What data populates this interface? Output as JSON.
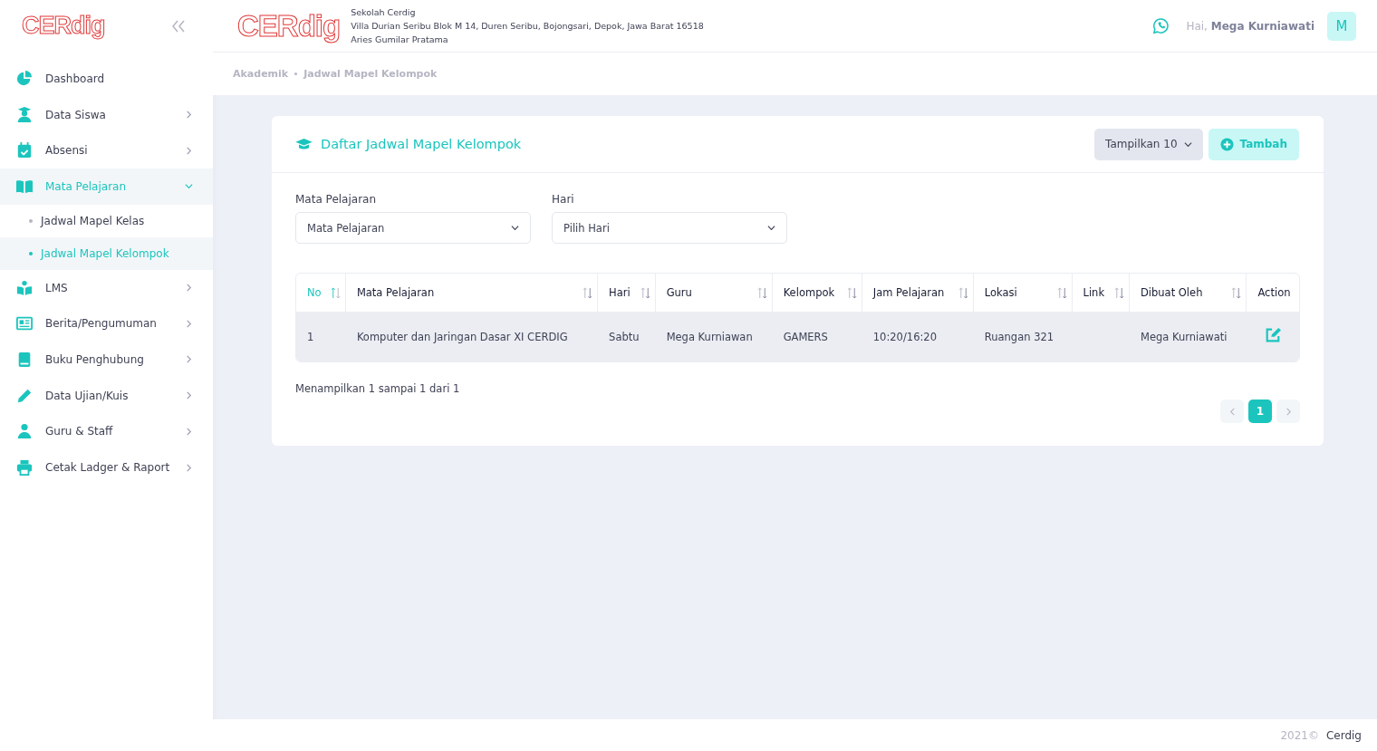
{
  "sidebar": {
    "logo": "CERdig",
    "items": [
      {
        "label": "Dashboard",
        "has_arrow": false,
        "selected": false
      },
      {
        "label": "Data Siswa",
        "has_arrow": true,
        "selected": false
      },
      {
        "label": "Absensi",
        "has_arrow": true,
        "selected": false
      },
      {
        "label": "Mata Pelajaran",
        "has_arrow": true,
        "selected": true,
        "expanded": true,
        "children": [
          {
            "label": "Jadwal Mapel Kelas",
            "selected": false
          },
          {
            "label": "Jadwal Mapel Kelompok",
            "selected": true
          }
        ]
      },
      {
        "label": "LMS",
        "has_arrow": true,
        "selected": false
      },
      {
        "label": "Berita/Pengumuman",
        "has_arrow": true,
        "selected": false
      },
      {
        "label": "Buku Penghubung",
        "has_arrow": true,
        "selected": false
      },
      {
        "label": "Data Ujian/Kuis",
        "has_arrow": true,
        "selected": false
      },
      {
        "label": "Guru & Staff",
        "has_arrow": true,
        "selected": false
      },
      {
        "label": "Cetak Ladger & Raport",
        "has_arrow": true,
        "selected": false
      }
    ]
  },
  "header": {
    "logo": "CERdig",
    "school_lines": [
      "Sekolah Cerdig",
      "Villa Durian Seribu Blok M 14, Duren Seribu, Bojongsari, Depok, Jawa Barat 16518",
      "Aries Gumilar Pratama"
    ],
    "greeting": "Hai,",
    "user_name": "Mega Kurniawati",
    "avatar": "M"
  },
  "breadcrumb": [
    "Akademik",
    "Jadwal Mapel Kelompok"
  ],
  "card": {
    "title": "Daftar Jadwal Mapel Kelompok",
    "show_button": "Tampilkan 10",
    "add_button": "Tambah",
    "filters": [
      {
        "label": "Mata Pelajaran",
        "value": "Mata Pelajaran"
      },
      {
        "label": "Hari",
        "value": "Pilih Hari"
      }
    ],
    "table": {
      "columns": [
        {
          "label": "No",
          "sortable": true,
          "sorted": true
        },
        {
          "label": "Mata Pelajaran",
          "sortable": true,
          "sorted": false
        },
        {
          "label": "Hari",
          "sortable": true,
          "sorted": false
        },
        {
          "label": "Guru",
          "sortable": true,
          "sorted": false
        },
        {
          "label": "Kelompok",
          "sortable": true,
          "sorted": false
        },
        {
          "label": "Jam Pelajaran",
          "sortable": true,
          "sorted": false
        },
        {
          "label": "Lokasi",
          "sortable": true,
          "sorted": false
        },
        {
          "label": "Link",
          "sortable": true,
          "sorted": false
        },
        {
          "label": "Dibuat Oleh",
          "sortable": true,
          "sorted": false
        },
        {
          "label": "Action",
          "sortable": false,
          "sorted": false
        }
      ],
      "rows": [
        {
          "cells": [
            "1",
            "Komputer dan Jaringan Dasar XI CERDIG",
            "Sabtu",
            "Mega Kurniawan",
            "GAMERS",
            "10:20/16:20",
            "Ruangan 321",
            "",
            "Mega Kurniawati"
          ]
        }
      ]
    },
    "summary": "Menampilkan 1 sampai 1 dari 1",
    "pages": [
      {
        "label": "1",
        "selected": true
      }
    ]
  },
  "footer": {
    "year": "2021©",
    "brand": "Cerdig"
  }
}
